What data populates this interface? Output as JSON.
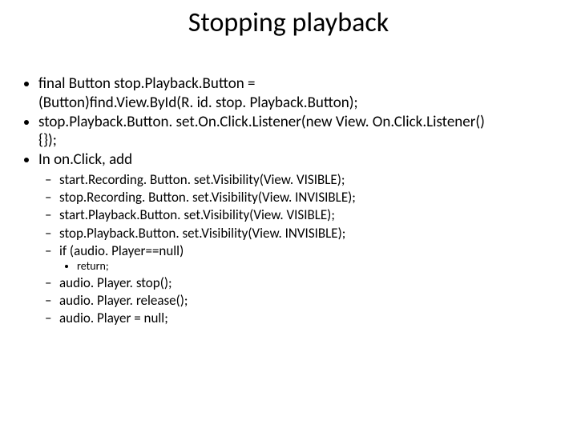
{
  "title": "Stopping playback",
  "bullets": {
    "b1a": "final Button stop.Playback.Button =",
    "b1b": "(Button)find.View.ById(R. id. stop. Playback.Button);",
    "b2a": "stop.Playback.Button. set.On.Click.Listener(new View. On.Click.Listener()",
    "b2b": "{});",
    "b3": "In on.Click, add",
    "s1": "start.Recording. Button. set.Visibility(View. VISIBLE);",
    "s2": "stop.Recording. Button. set.Visibility(View. INVISIBLE);",
    "s3": "start.Playback.Button. set.Visibility(View. VISIBLE);",
    "s4": "stop.Playback.Button. set.Visibility(View. INVISIBLE);",
    "s5": "if (audio. Player==null)",
    "s5r": "return;",
    "s6": "audio. Player. stop();",
    "s7": "audio. Player. release();",
    "s8": "audio. Player = null;"
  }
}
